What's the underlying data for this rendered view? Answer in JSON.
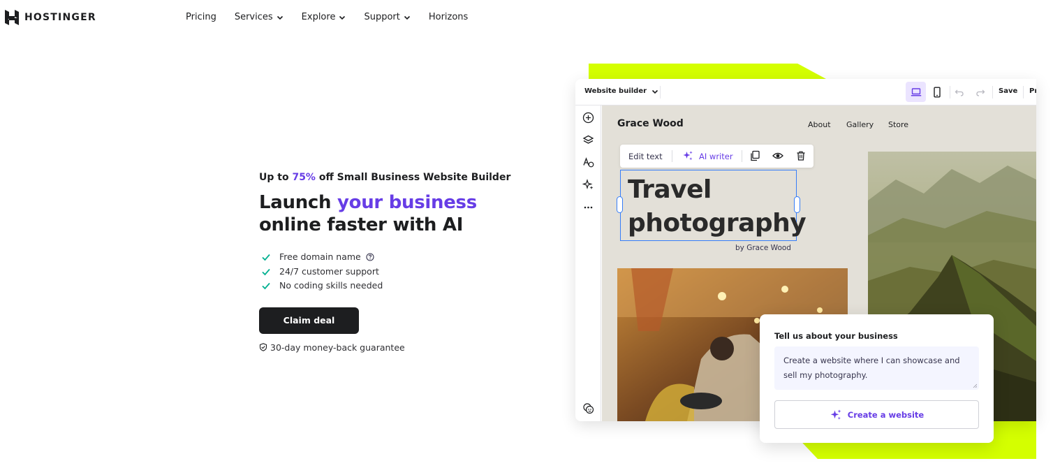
{
  "brand": {
    "name": "HOSTINGER"
  },
  "nav": {
    "items": [
      {
        "label": "Pricing",
        "has_dropdown": false
      },
      {
        "label": "Services",
        "has_dropdown": true
      },
      {
        "label": "Explore",
        "has_dropdown": true
      },
      {
        "label": "Support",
        "has_dropdown": true
      },
      {
        "label": "Horizons",
        "has_dropdown": false
      }
    ]
  },
  "hero": {
    "eyebrow_prefix": "Up to ",
    "eyebrow_percent": "75%",
    "eyebrow_suffix": " off Small Business Website Builder",
    "headline_part1": "Launch ",
    "headline_accent": "your business",
    "headline_part2": "online faster with AI",
    "features": [
      "Free domain name",
      "24/7 customer support",
      "No coding skills needed"
    ],
    "cta_label": "Claim deal",
    "guarantee": "30-day money-back guarantee"
  },
  "builder": {
    "mode_label": "Website builder",
    "save_label": "Save",
    "preview_label": "Pr",
    "site": {
      "title": "Grace Wood",
      "nav": [
        "About",
        "Gallery",
        "Store"
      ],
      "edit_text_label": "Edit text",
      "ai_writer_label": "AI writer",
      "heading_line1": "Travel",
      "heading_line2": "photography",
      "byline": "by Grace Wood"
    }
  },
  "ai_card": {
    "title": "Tell us about your business",
    "prompt_text": "Create a website where I can showcase and sell my photography.",
    "button_label": "Create a website"
  },
  "colors": {
    "accent": "#673de6",
    "lime": "#d4ff00",
    "dark": "#1d1e20",
    "check": "#00b090",
    "selection": "#357df9"
  }
}
